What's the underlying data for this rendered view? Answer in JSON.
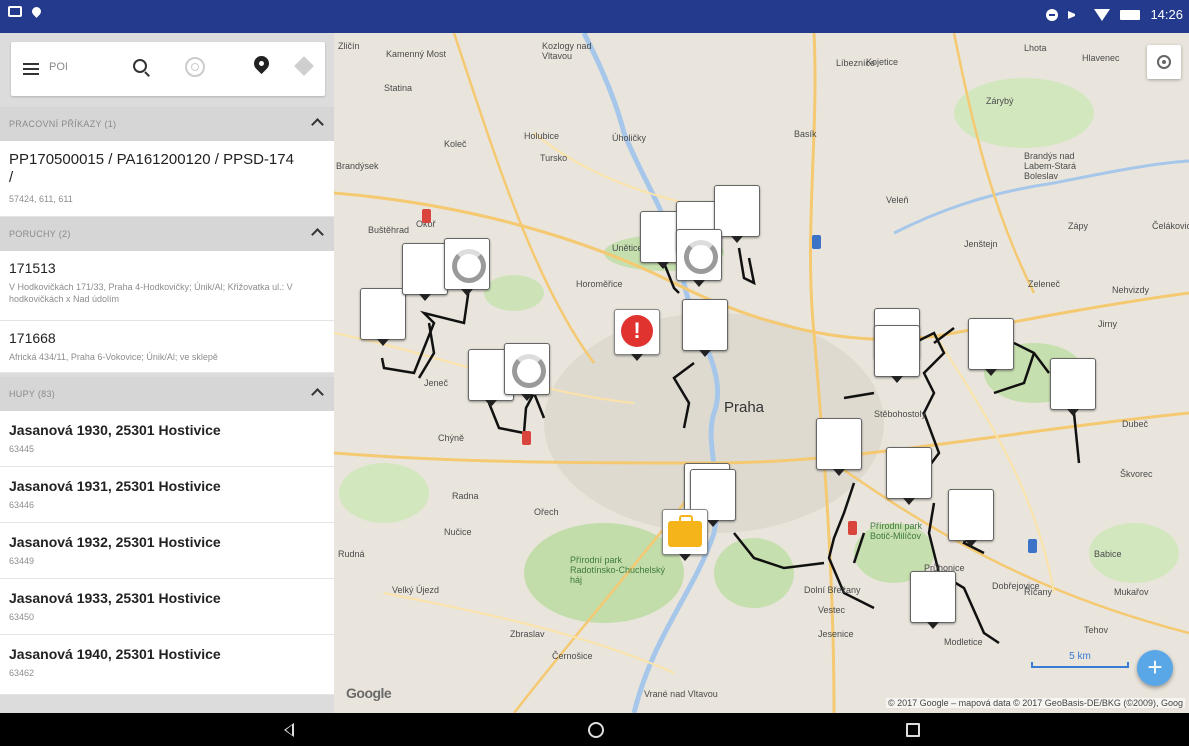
{
  "status_bar": {
    "time": "14:26"
  },
  "search": {
    "placeholder": "POI"
  },
  "sections": [
    {
      "header": "PRACOVNÍ PŘÍKAZY (1)",
      "items": [
        {
          "title": "PP170500015 / PA161200120 / PPSD-174 /",
          "sub": "57424, 611, 611"
        }
      ]
    },
    {
      "header": "PORUCHY (2)",
      "items": [
        {
          "title": "171513",
          "sub": "V Hodkovičkách 171/33, Praha 4-Hodkovičky; Únik/Al; Křižovatka ul.: V hodkovičkách x Nad údolím"
        },
        {
          "title": "171668",
          "sub": "Africká 434/11, Praha 6-Vokovice; Únik/Al; ve sklepě"
        }
      ]
    },
    {
      "header": "HUPY (83)",
      "items": [
        {
          "title": "Jasanová 1930, 25301 Hostivice",
          "sub": "63445"
        },
        {
          "title": "Jasanová 1931, 25301 Hostivice",
          "sub": "63446"
        },
        {
          "title": "Jasanová 1932, 25301 Hostivice",
          "sub": "63449"
        },
        {
          "title": "Jasanová 1933, 25301 Hostivice",
          "sub": "63450"
        },
        {
          "title": "Jasanová 1940, 25301 Hostivice",
          "sub": "63462"
        }
      ]
    }
  ],
  "map": {
    "city_label": "Praha",
    "labels": [
      "Zličín",
      "Kamenný Most",
      "Kozlogy nad Vltavou",
      "Líbezníce",
      "Kojetice",
      "Lhota",
      "Hlavenec",
      "Zárybý",
      "Statina",
      "Koleč",
      "Holubice",
      "Úholičky",
      "Tursko",
      "Basík",
      "Brandýs nad Labem-Stará Boleslav",
      "Brandýsek",
      "Okoř",
      "Veleň",
      "Zápy",
      "Čelákovice",
      "Buštěhrad",
      "Unětice",
      "Horoměřice",
      "Jenštejn",
      "Zeleneč",
      "Nehvizdy",
      "Jirny",
      "Jeneč",
      "Chýně",
      "Dubeč",
      "Radna",
      "Nučice",
      "Ořech",
      "Škvorec",
      "Babice",
      "Rudná",
      "Velký Újezd",
      "Přírodní park Radotínsko-Chuchelský háj",
      "Vestec",
      "Jesenice",
      "Modletice",
      "Říčany",
      "Mukařov",
      "Tehov",
      "Černošice",
      "Vrané nad Vltavou",
      "Stěbohostoly",
      "Přírodní park Botič-Milíčov",
      "Průhonice",
      "Dobřejovice",
      "Dolní Břežany",
      "Zbraslav"
    ],
    "scale_label": "5 km",
    "logo": "Google",
    "attribution": "© 2017 Google – mapová data © 2017 GeoBasis-DE/BKG (©2009), Goog"
  },
  "accent_colors": {
    "status_bar": "#243a8d",
    "fab": "#5aa7e8",
    "warning": "#e0332f",
    "bag": "#f4b41a"
  },
  "icons": [
    "menu-icon",
    "search-icon",
    "layer-circle-icon",
    "pin-icon",
    "layers-icon",
    "locate-icon",
    "add-icon",
    "back-icon",
    "home-icon",
    "recent-apps-icon"
  ]
}
